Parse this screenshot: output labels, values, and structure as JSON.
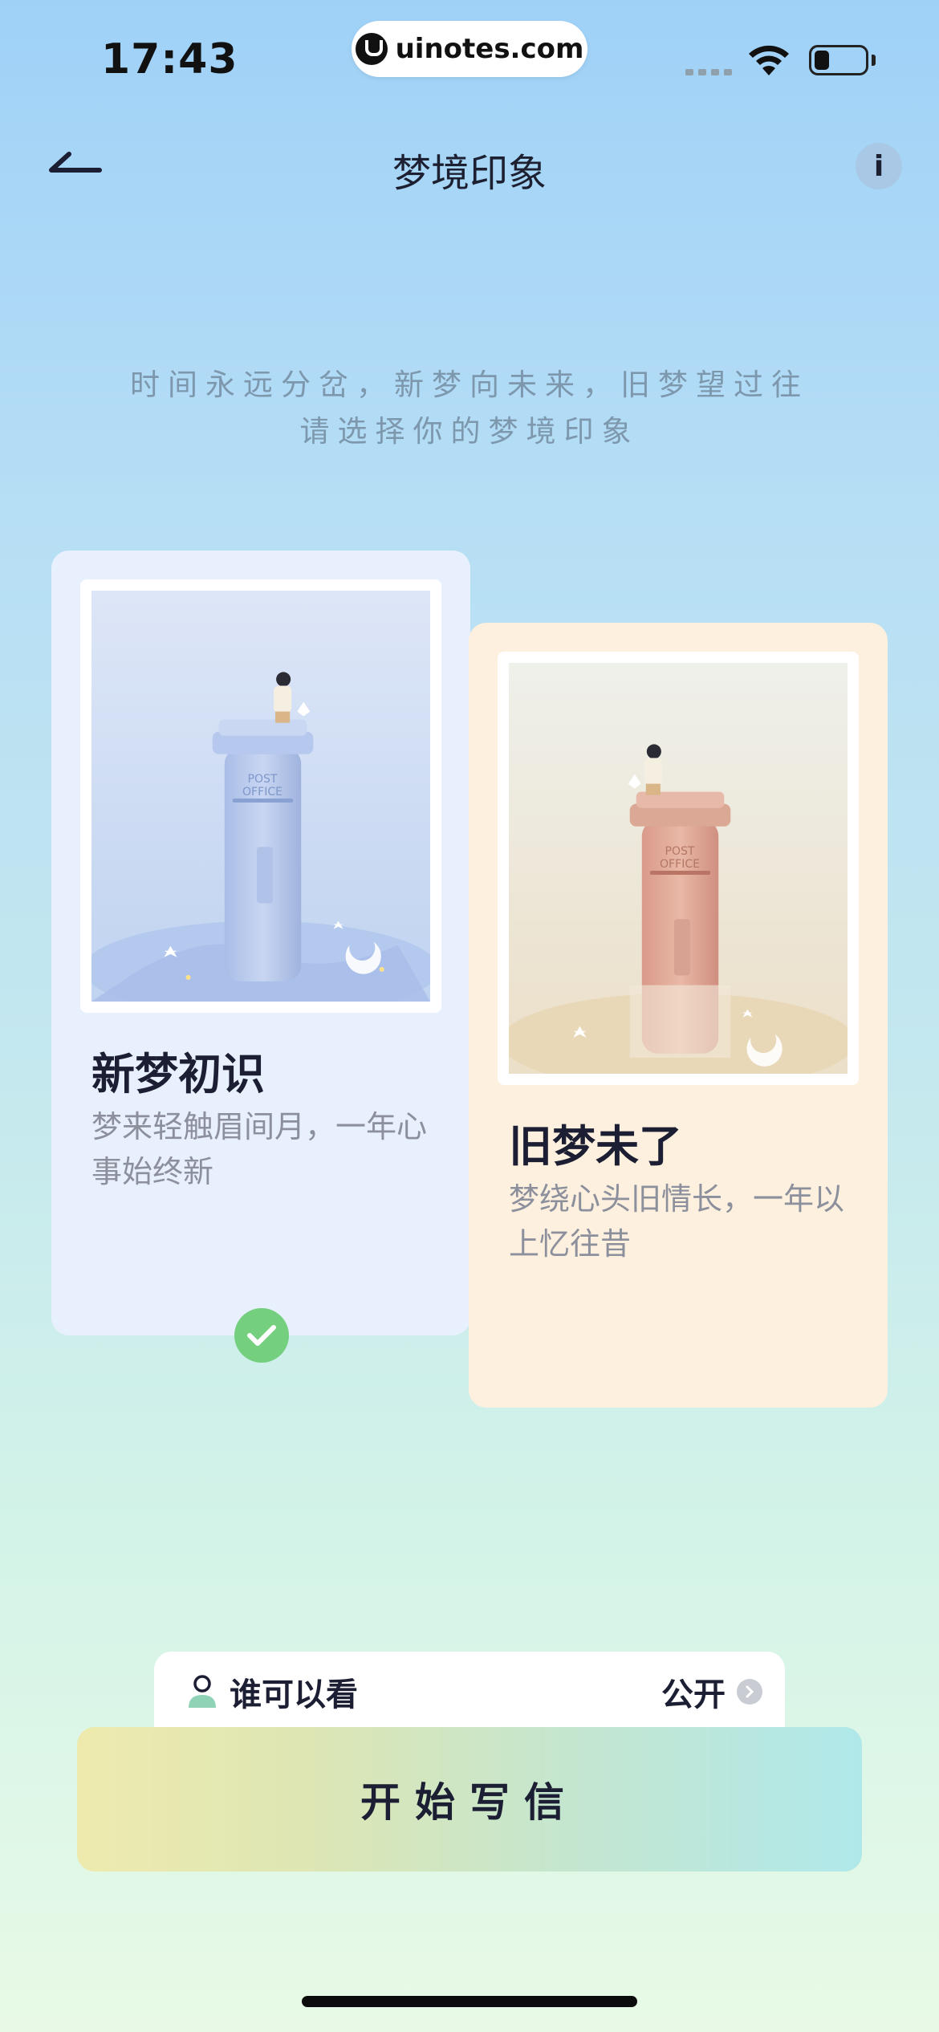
{
  "status_bar": {
    "time": "17:43",
    "watermark": "uinotes.com"
  },
  "nav": {
    "title": "梦境印象",
    "info_icon": "i"
  },
  "subtitle": {
    "line1": "时间永远分岔，新梦向未来，旧梦望过往",
    "line2": "请选择你的梦境印象"
  },
  "cards": [
    {
      "title": "新梦初识",
      "desc": "梦来轻触眉间月，一年心事始终新",
      "selected": true,
      "theme": "#e9f0fd"
    },
    {
      "title": "旧梦未了",
      "desc": "梦绕心头旧情长，一年以上忆往昔",
      "selected": false,
      "theme": "#fdf0de"
    }
  ],
  "postbox_text": {
    "line1": "POST",
    "line2": "OFFICE"
  },
  "visibility": {
    "label": "谁可以看",
    "value": "公开"
  },
  "start_button": {
    "label": "开始写信"
  },
  "colors": {
    "check_green": "#74cf7e",
    "accent_dark": "#1c1f33"
  }
}
